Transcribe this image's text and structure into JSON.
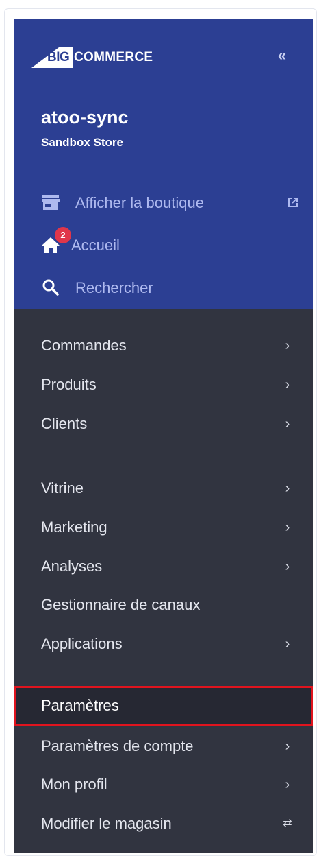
{
  "brand": {
    "logo_big": "BIG",
    "logo_commerce": "COMMERCE",
    "collapse_label": "«"
  },
  "store": {
    "name": "atoo-sync",
    "type": "Sandbox Store"
  },
  "quick_links": [
    {
      "label": "Afficher la boutique",
      "icon": "storefront-icon",
      "external": true
    },
    {
      "label": "Accueil",
      "icon": "home-icon",
      "badge": "2"
    },
    {
      "label": "Rechercher",
      "icon": "search-icon"
    }
  ],
  "nav": {
    "group1": [
      {
        "label": "Commandes",
        "chevron": "›"
      },
      {
        "label": "Produits",
        "chevron": "›"
      },
      {
        "label": "Clients",
        "chevron": "›"
      }
    ],
    "group2": [
      {
        "label": "Vitrine",
        "chevron": "›"
      },
      {
        "label": "Marketing",
        "chevron": "›"
      },
      {
        "label": "Analyses",
        "chevron": "›"
      },
      {
        "label": "Gestionnaire de canaux",
        "chevron": ""
      },
      {
        "label": "Applications",
        "chevron": "›"
      }
    ],
    "group3": [
      {
        "label": "Paramètres",
        "chevron": "",
        "active": true
      },
      {
        "label": "Paramètres de compte",
        "chevron": "›"
      },
      {
        "label": "Mon profil",
        "chevron": "›"
      },
      {
        "label": "Modifier le magasin",
        "chevron": "⇄"
      }
    ]
  },
  "colors": {
    "top_bg": "#2c3f93",
    "bottom_bg": "#313440",
    "link_color": "#aeb9ef",
    "badge": "#e0364a",
    "highlight_border": "#e0141e"
  }
}
